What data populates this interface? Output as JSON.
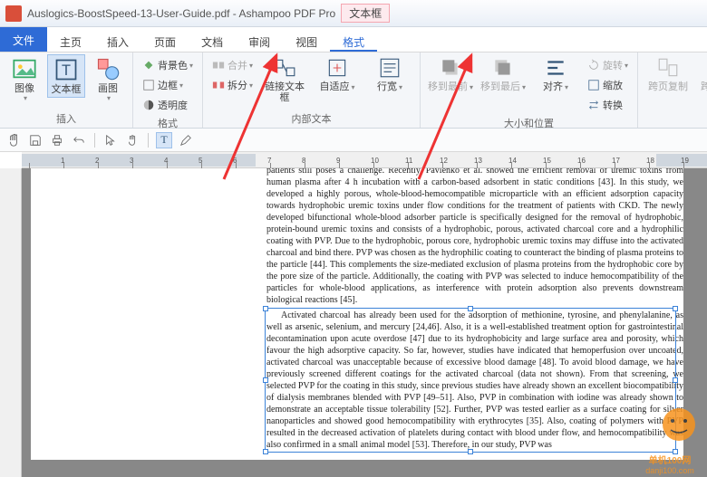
{
  "title": {
    "document": "Auslogics-BoostSpeed-13-User-Guide.pdf",
    "app": "Ashampoo PDF Pro",
    "badge": "文本框"
  },
  "menu": {
    "file": "文件",
    "items": [
      "主页",
      "插入",
      "页面",
      "文档",
      "审阅",
      "视图",
      "格式"
    ],
    "active_index": 6
  },
  "ribbon": {
    "groups": {
      "insert": {
        "label": "插入",
        "image": "图像",
        "textframe": "文本框",
        "draw": "画图"
      },
      "format": {
        "label": "格式",
        "bgcolor": "背景色",
        "border": "边框",
        "opacity": "透明度",
        "merge": "合并",
        "split": "拆分"
      },
      "innertext": {
        "label": "内部文本",
        "linkframe": "链接文本框",
        "autofit": "自适应",
        "linewidth": "行宽"
      },
      "sizepos": {
        "label": "大小和位置",
        "tofront": "移到最前",
        "toback": "移到最后",
        "align": "对齐",
        "rotate": "旋转",
        "scale": "缩放",
        "convert": "转换"
      },
      "crosspage": {
        "copy": "跨页复制",
        "delete": "跨页删除"
      }
    }
  },
  "body": {
    "para1": "patients still poses a challenge. Recently, Pavlenko et al. showed the efficient removal of uremic toxins from human plasma after 4 h incubation with a carbon-based adsorbent in static conditions [43]. In this study, we developed a highly porous, whole-blood-hemocompatible microparticle with an efficient adsorption capacity towards hydrophobic uremic toxins under flow conditions for the treatment of patients with CKD. The newly developed bifunctional whole-blood adsorber particle is specifically designed for the removal of hydrophobic, protein-bound uremic toxins and consists of a hydrophobic, porous, activated charcoal core and a hydrophilic coating with PVP. Due to the hydrophobic, porous core, hydrophobic uremic toxins may diffuse into the activated charcoal and bind there. PVP was chosen as the hydrophilic coating to counteract the binding of plasma proteins to the particle [44]. This complements the size-mediated exclusion of plasma proteins from the hydrophobic core by the pore size of the particle. Additionally, the coating with PVP was selected to induce hemocompatibility of the particles for whole-blood applications, as interference with protein adsorption also prevents downstream biological reactions [45].",
    "para2_start": "Activated charcoal has already been used for the adsorption of methionine, tyrosine, and phenylalanine, as well as arsenic, selenium, and mercury [24,46]. Also, it is a well-established treatment option for gastrointestinal decontamination upon acute overdose [47] due to its hydrophobicity and large surface area and porosity, which favour the high adsorptive capacity. So far, however, studies have indicated that hemoperfusion over uncoated, activated charcoal was unacceptable because of excessive blood damage [48]. To avoid blood damage, we have previously screened different coatings for the activated charcoal (data not shown). From that screening, we selected PVP for the coating in this study, since previous studies have already shown an excellent biocompatibility of dialysis membranes blended with PVP [49–51]. Also, PVP in combination with iodine was already shown to demonstrate an acceptable tissue tolerability [52]. Further, PVP was tested earlier as a surface coating for silver nanoparticles and showed good hemocompatibility with erythrocytes [35]. Also, coating of polymers with PVP resulted in the decreased activation of platelets during contact with blood under flow, and hemocompatibility was also confirmed in a small animal model [53]. Therefore, in our study, PVP was"
  },
  "watermark": {
    "line1": "单机100网",
    "line2": "danji100.com"
  }
}
